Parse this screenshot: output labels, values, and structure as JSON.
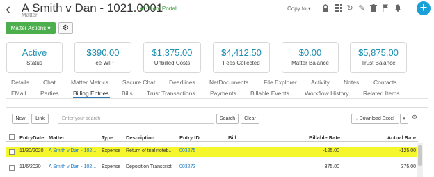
{
  "header": {
    "back_icon": "chevron-left-icon",
    "title": "A Smith v Dan - 1021.0001",
    "client_portal": "Client Portal",
    "subtitle": "Matter",
    "copy_to": "Copy to",
    "icons": [
      "lock-icon",
      "grid-icon",
      "refresh-icon",
      "edit-icon",
      "trash-icon",
      "flag-icon",
      "bell-icon"
    ],
    "add_label": "+"
  },
  "toolbar": {
    "matter_actions": "Matter Actions",
    "settings_icon": "gear-icon"
  },
  "cards": [
    {
      "value": "Active",
      "label": "Status"
    },
    {
      "value": "$390.00",
      "label": "Fee WIP"
    },
    {
      "value": "$1,375.00",
      "label": "Unbilled Costs"
    },
    {
      "value": "$4,412.50",
      "label": "Fees Collected"
    },
    {
      "value": "$0.00",
      "label": "Matter Balance"
    },
    {
      "value": "$5,875.00",
      "label": "Trust Balance"
    }
  ],
  "tabs_row1": [
    "Details",
    "Chat",
    "Matter Metrics",
    "Secure Chat",
    "Deadlines",
    "NetDocuments",
    "File Explorer",
    "Activity",
    "Notes",
    "Contacts"
  ],
  "tabs_row2": [
    "EMail",
    "Parties",
    "Billing Entries",
    "Bills",
    "Trust Transactions",
    "Payments",
    "Billable Events",
    "Workflow History",
    "Related Items"
  ],
  "active_tab": "Billing Entries",
  "grid_toolbar": {
    "new_label": "New",
    "link_label": "Link",
    "search_placeholder": "Enter your search",
    "search_label": "Search",
    "clear_label": "Clear",
    "download_label": "Download Excel"
  },
  "table": {
    "columns": [
      "EntryDate",
      "Matter",
      "Type",
      "Description",
      "Entry ID",
      "Bill",
      "Billable Rate",
      "Actual Rate"
    ],
    "rows": [
      {
        "date": "11/30/2020",
        "matter": "A Smith v Dan - 102...",
        "type": "Expense",
        "description": "Return of trial noteb...",
        "entry_id": "003275",
        "bill": "",
        "billable_rate": "-125.00",
        "actual_rate": "-125.00",
        "highlighted": true
      },
      {
        "date": "11/6/2020",
        "matter": "A Smith v Dan - 102...",
        "type": "Expense",
        "description": "Deposition Transcript",
        "entry_id": "003273",
        "bill": "",
        "billable_rate": "375.00",
        "actual_rate": "375.00",
        "highlighted": false
      }
    ]
  },
  "colors": {
    "accent": "#1a8fb0",
    "green": "#4cae4c",
    "highlight": "#f6f62c",
    "link": "#1b78c8",
    "add": "#1aa0d8"
  }
}
